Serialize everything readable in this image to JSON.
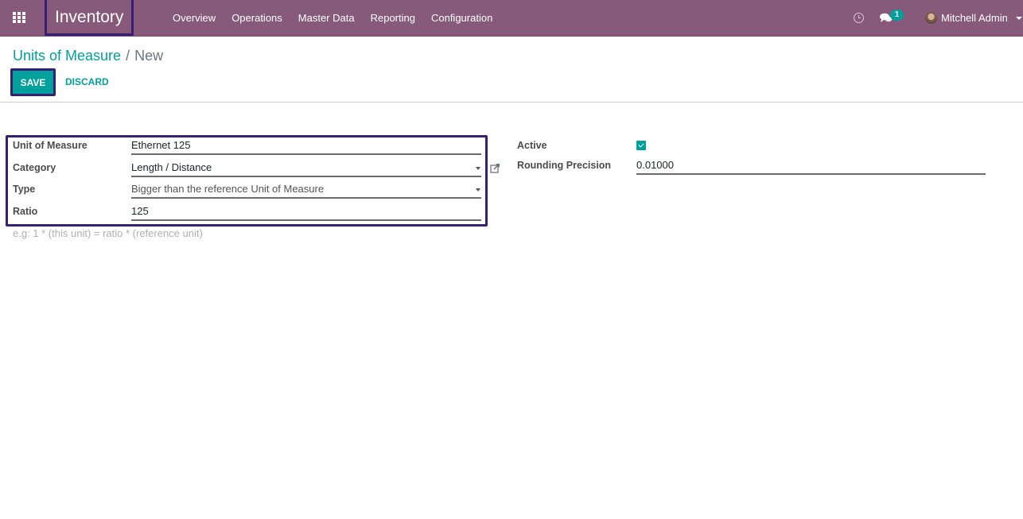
{
  "navbar": {
    "app_title": "Inventory",
    "menu": [
      "Overview",
      "Operations",
      "Master Data",
      "Reporting",
      "Configuration"
    ],
    "icons": {
      "apps": "apps-grid-icon",
      "activity": "clock-icon",
      "messages": "chat-icon"
    },
    "messages_count": "1",
    "user_name": "Mitchell Admin",
    "colors": {
      "bar": "#875a7b",
      "badge": "#00a09d",
      "highlight": "#372073"
    }
  },
  "control_panel": {
    "breadcrumb": {
      "parent": "Units of Measure",
      "separator": "/",
      "current": "New"
    },
    "save_label": "SAVE",
    "discard_label": "DISCARD"
  },
  "form": {
    "left": [
      {
        "label": "Unit of Measure",
        "value": "Ethernet 125",
        "kind": "text"
      },
      {
        "label": "Category",
        "value": "Length / Distance",
        "kind": "many2one"
      },
      {
        "label": "Type",
        "value": "Bigger than the reference Unit of Measure",
        "kind": "selection"
      },
      {
        "label": "Ratio",
        "value": "125",
        "kind": "float"
      }
    ],
    "ratio_hint": "e.g: 1 * (this unit) = ratio * (reference unit)",
    "right": {
      "active_label": "Active",
      "active": true,
      "rounding_label": "Rounding Precision",
      "rounding_value": "0.01000"
    },
    "accent": "#00a09d"
  }
}
